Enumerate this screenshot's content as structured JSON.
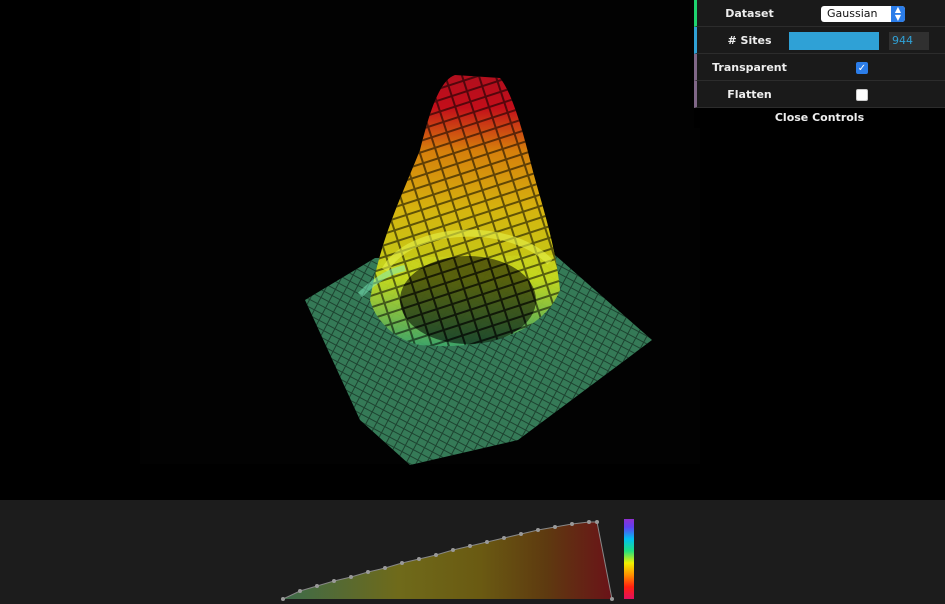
{
  "controls": {
    "dataset_label": "Dataset",
    "dataset_value": "Gaussian",
    "sites_label": "# Sites",
    "sites_value": "944",
    "sites_fraction": 1.0,
    "transparent_label": "Transparent",
    "transparent_checked": true,
    "flatten_label": "Flatten",
    "flatten_checked": false,
    "close_label": "Close Controls"
  },
  "colors": {
    "dataset_accent": "#1ed36f",
    "number_accent": "#2fa1d6",
    "boolean_accent": "#806787",
    "checkbox_on": "#2b7de9",
    "surface_low": "#3fa86a",
    "surface_mid": "#e8e11a",
    "surface_high": "#d40f1c"
  },
  "icons": {
    "select_arrow": "chevron-updown-icon",
    "checkbox_check": "checkmark-icon"
  }
}
